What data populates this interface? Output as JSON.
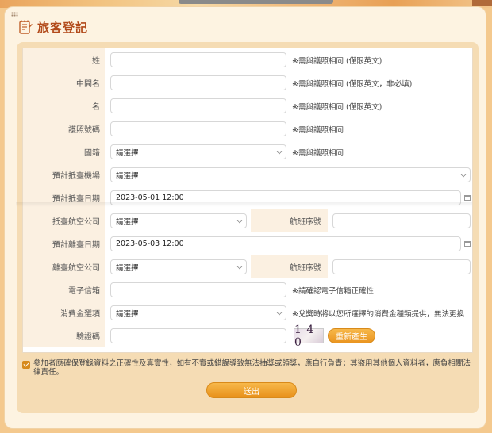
{
  "header": {
    "title": "旅客登記"
  },
  "fields": {
    "surname": {
      "label": "姓",
      "note": "※需與護照相同 (僅限英文)"
    },
    "middle_name": {
      "label": "中間名",
      "note": "※需與護照相同 (僅限英文，非必填)"
    },
    "given_name": {
      "label": "名",
      "note": "※需與護照相同 (僅限英文)"
    },
    "passport": {
      "label": "護照號碼",
      "note": "※需與護照相同"
    },
    "nationality": {
      "label": "國籍",
      "value": "請選擇",
      "note": "※需與護照相同"
    },
    "arrival_airport": {
      "label": "預計抵臺機場",
      "value": "請選擇"
    },
    "arrival_date": {
      "label": "預計抵臺日期",
      "value": "2023-05-01 12:00"
    },
    "arrival_airline": {
      "label": "抵臺航空公司",
      "value": "請選擇",
      "flight_label": "航班序號"
    },
    "departure_date": {
      "label": "預計離臺日期",
      "value": "2023-05-03 12:00"
    },
    "departure_airline": {
      "label": "離臺航空公司",
      "value": "請選擇",
      "flight_label": "航班序號"
    },
    "email": {
      "label": "電子信箱",
      "note": "※請確認電子信箱正確性"
    },
    "amount": {
      "label": "消費金選項",
      "value": "請選擇",
      "note": "※兌獎時將以您所選擇的消費金種類提供，無法更換"
    },
    "captcha": {
      "label": "驗證碼",
      "captcha_text": "1 4 0",
      "refresh_label": "重新產生"
    }
  },
  "agreement": {
    "text": "參加者應確保登錄資料之正確性及真實性，如有不實或錯誤導致無法抽獎或領獎，應自行負責；其盜用其他個人資料者，應負相關法律責任。"
  },
  "submit_label": "送出"
}
